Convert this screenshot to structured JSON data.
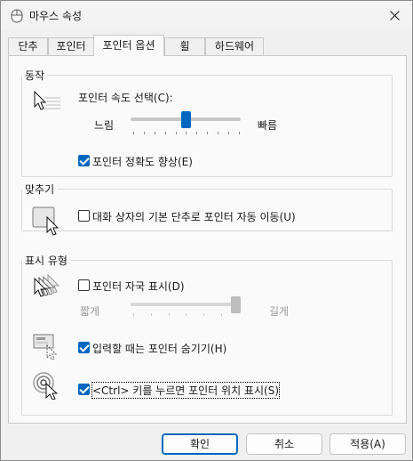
{
  "window": {
    "title": "마우스 속성",
    "close_glyph": "✕"
  },
  "tabs": [
    {
      "label": "단추",
      "active": false
    },
    {
      "label": "포인터",
      "active": false
    },
    {
      "label": "포인터 옵션",
      "active": true
    },
    {
      "label": "휠",
      "active": false
    },
    {
      "label": "하드웨어",
      "active": false
    }
  ],
  "motion": {
    "group_label": "동작",
    "speed_label": "포인터 속도 선택(C):",
    "slow_label": "느림",
    "fast_label": "빠름",
    "speed_value": 0.5,
    "precision_label": "포인터 정확도 향상(E)",
    "precision_checked": true
  },
  "snap_to": {
    "group_label": "맞추기",
    "label": "대화 상자의 기본 단추로 포인터 자동 이동(U)",
    "checked": false
  },
  "visibility": {
    "group_label": "표시 유형",
    "trails_label": "포인터 자국 표시(D)",
    "trails_checked": false,
    "short_label": "짧게",
    "long_label": "길게",
    "trails_value": 1.0,
    "hide_label": "입력할 때는 포인터 숨기기(H)",
    "hide_checked": true,
    "ctrl_label": "<Ctrl> 키를 누르면 포인터 위치 표시(S)",
    "ctrl_checked": true
  },
  "buttons": {
    "ok": "확인",
    "cancel": "취소",
    "apply": "적용(A)"
  },
  "colors": {
    "accent": "#0067c0",
    "disabled": "#9a9a9a"
  }
}
